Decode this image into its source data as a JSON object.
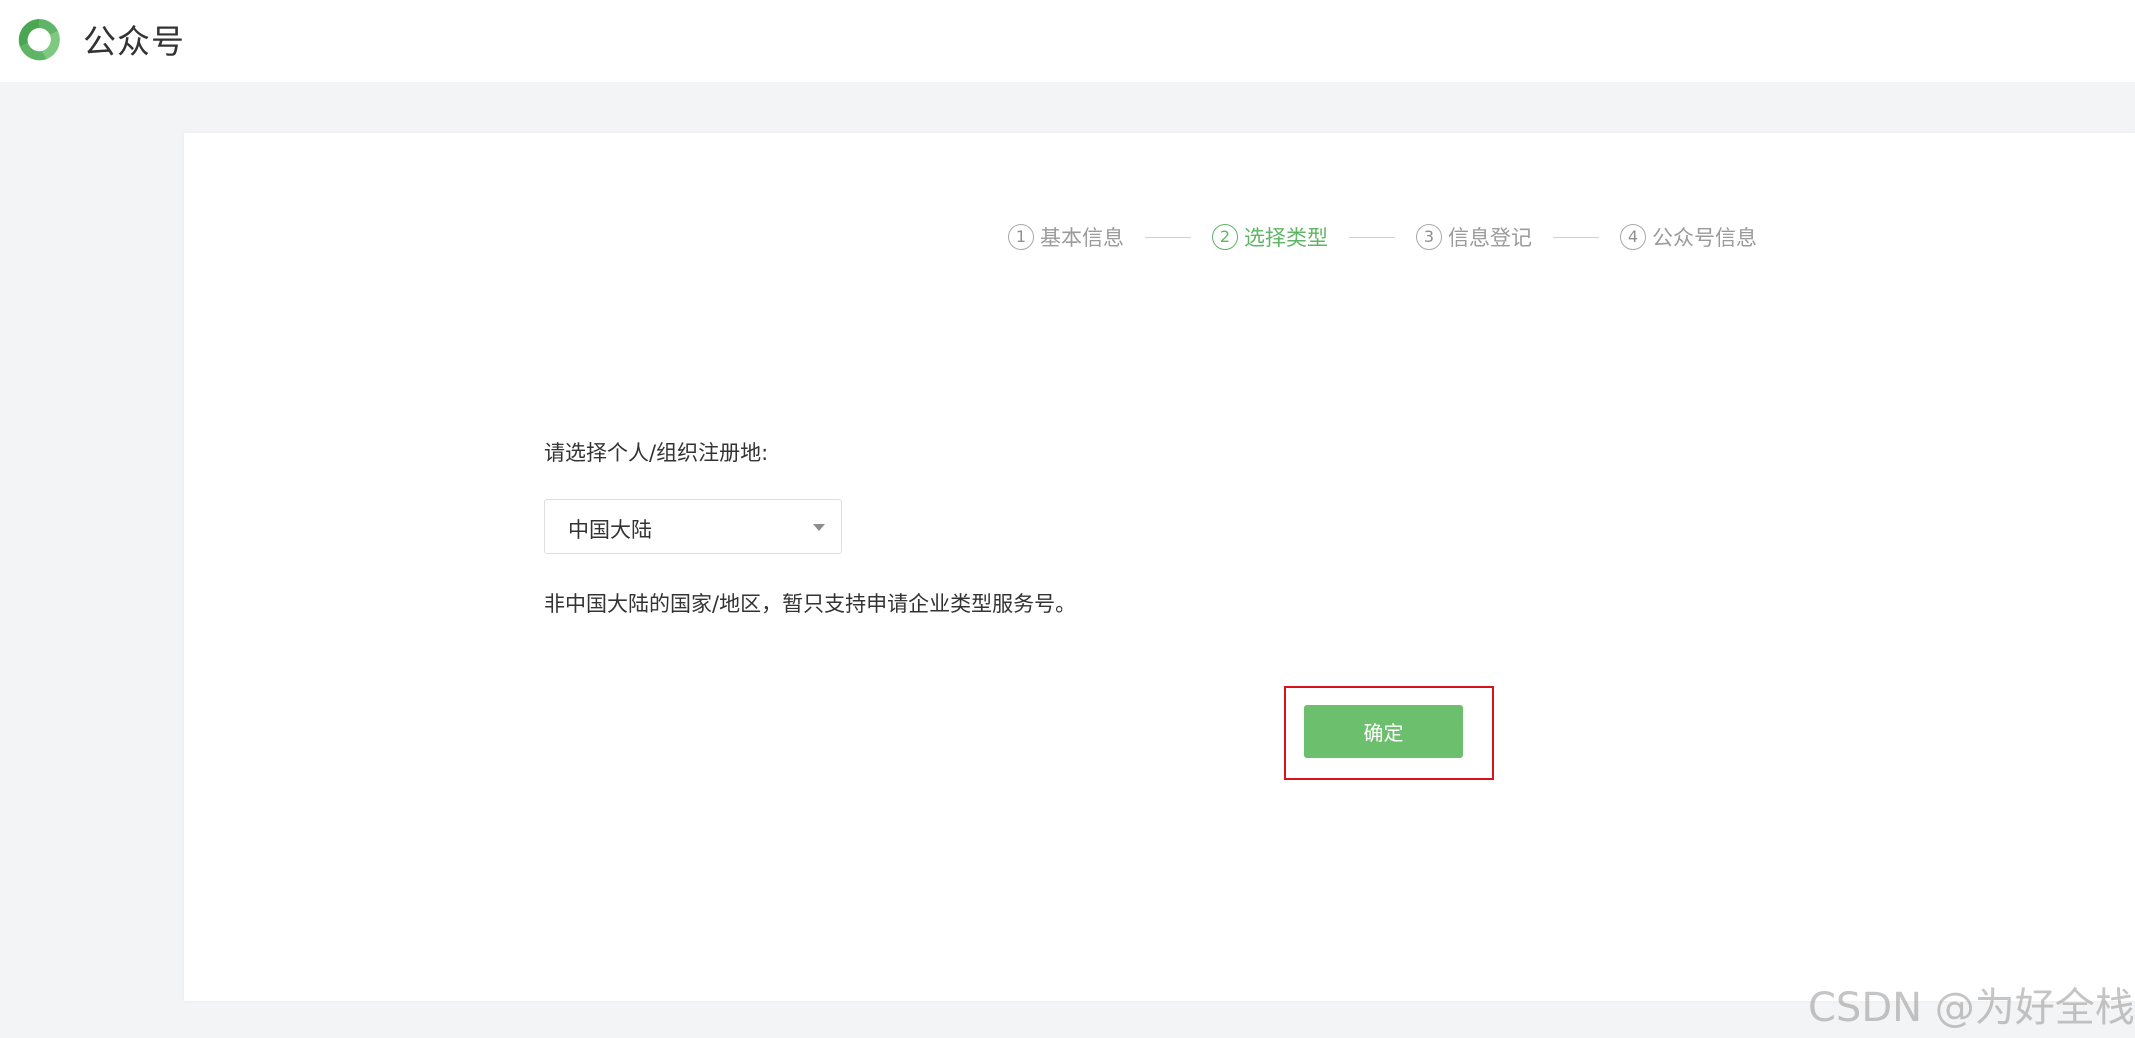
{
  "header": {
    "title": "公众号",
    "logo_icon": "wechat-official-account-logo-icon",
    "brand_color": "#5fb565"
  },
  "steps": [
    {
      "num": "1",
      "label": "基本信息",
      "active": false
    },
    {
      "num": "2",
      "label": "选择类型",
      "active": true
    },
    {
      "num": "3",
      "label": "信息登记",
      "active": false
    },
    {
      "num": "4",
      "label": "公众号信息",
      "active": false
    }
  ],
  "form": {
    "region_label": "请选择个人/组织注册地:",
    "region_value": "中国大陆",
    "dropdown_icon": "caret-down-icon",
    "hint": "非中国大陆的国家/地区，暂只支持申请企业类型服务号。",
    "confirm_label": "确定",
    "confirm_color": "#6cbf6d",
    "highlight_color": "#d7141e"
  },
  "watermark": "CSDN @为好全栈"
}
